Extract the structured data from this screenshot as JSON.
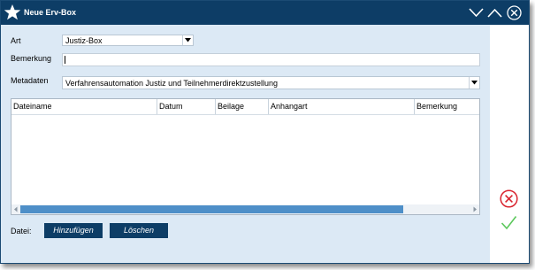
{
  "window": {
    "title": "Neue Erv-Box",
    "accent_color": "#0d3d66",
    "icons": [
      "star-icon",
      "chevron-down-icon",
      "chevron-up-icon",
      "close-icon"
    ]
  },
  "form": {
    "art_label": "Art",
    "art_value": "Justiz-Box",
    "bemerkung_label": "Bemerkung",
    "bemerkung_value": "",
    "metadaten_label": "Metadaten",
    "metadaten_value": "Verfahrensautomation Justiz und Teilnehmerdirektzustellung"
  },
  "table": {
    "columns": [
      "Dateiname",
      "Datum",
      "Beilage",
      "Anhangart",
      "Bemerkung"
    ],
    "rows": []
  },
  "footer": {
    "datei_label": "Datei:",
    "add_label": "Hinzufügen",
    "delete_label": "Löschen"
  },
  "side": {
    "icons": [
      "cancel-icon",
      "confirm-check-icon"
    ],
    "cancel_color": "#d9232e",
    "confirm_color": "#5cc85c"
  }
}
